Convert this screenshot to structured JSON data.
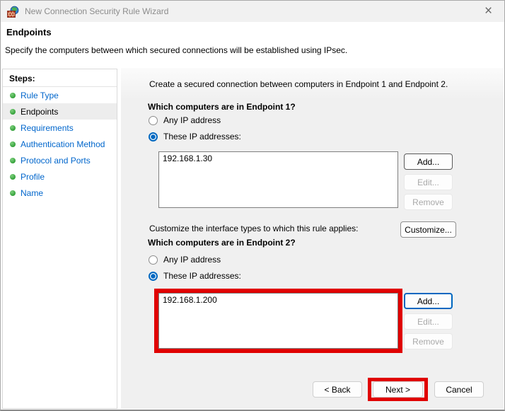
{
  "window": {
    "title": "New Connection Security Rule Wizard",
    "icons": {
      "app_icon": "firewall-globe-brick-wall",
      "close_icon": "×"
    }
  },
  "header": {
    "title": "Endpoints",
    "description": "Specify the computers between which secured connections will be established using IPsec."
  },
  "sidebar": {
    "title": "Steps:",
    "active_step": "Endpoints",
    "items": [
      {
        "label": "Rule Type"
      },
      {
        "label": "Endpoints"
      },
      {
        "label": "Requirements"
      },
      {
        "label": "Authentication Method"
      },
      {
        "label": "Protocol and Ports"
      },
      {
        "label": "Profile"
      },
      {
        "label": "Name"
      }
    ]
  },
  "content": {
    "intro": "Create a secured connection between computers in Endpoint 1 and Endpoint 2.",
    "endpoint1": {
      "question": "Which computers are in Endpoint 1?",
      "any_label": "Any IP address",
      "these_label": "These IP addresses:",
      "selected": "these",
      "addresses": [
        "192.168.1.30"
      ],
      "add_label": "Add...",
      "edit_label": "Edit...",
      "remove_label": "Remove"
    },
    "customize": {
      "label": "Customize the interface types to which this rule applies:",
      "button_label": "Customize..."
    },
    "endpoint2": {
      "question": "Which computers are in Endpoint 2?",
      "any_label": "Any IP address",
      "these_label": "These IP addresses:",
      "selected": "these",
      "addresses": [
        "192.168.1.200"
      ],
      "add_label": "Add...",
      "edit_label": "Edit...",
      "remove_label": "Remove"
    },
    "footer": {
      "back_label": "< Back",
      "next_label": "Next >",
      "cancel_label": "Cancel"
    }
  },
  "colors": {
    "accent": "#0067c0",
    "link": "#0066cc",
    "step_bullet": "#2f9e35",
    "annotation": "#e00000",
    "panel_gray": "#f0f0f0"
  }
}
